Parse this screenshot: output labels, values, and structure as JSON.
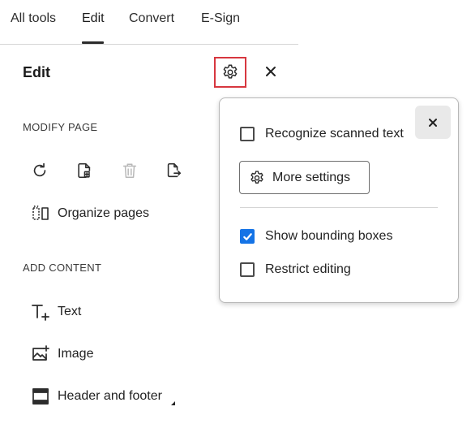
{
  "tabs": [
    {
      "label": "All tools"
    },
    {
      "label": "Edit",
      "active": true
    },
    {
      "label": "Convert"
    },
    {
      "label": "E-Sign"
    }
  ],
  "panel": {
    "title": "Edit",
    "settings_icon": "gear-icon",
    "close_icon": "close-icon"
  },
  "modify_page": {
    "label": "MODIFY PAGE",
    "icons": [
      "rotate-icon",
      "insert-page-icon",
      "delete-page-icon",
      "extract-page-icon"
    ],
    "organize_label": "Organize pages"
  },
  "add_content": {
    "label": "ADD CONTENT",
    "items": [
      {
        "label": "Text",
        "icon": "add-text-icon"
      },
      {
        "label": "Image",
        "icon": "add-image-icon"
      },
      {
        "label": "Header and footer",
        "icon": "header-footer-icon"
      }
    ]
  },
  "popover": {
    "recognize_text": {
      "label": "Recognize scanned text",
      "checked": false
    },
    "more_settings_label": "More settings",
    "show_bounding_boxes": {
      "label": "Show bounding boxes",
      "checked": true
    },
    "restrict_editing": {
      "label": "Restrict editing",
      "checked": false
    }
  },
  "colors": {
    "highlight_border": "#d7373f",
    "checkbox_accent": "#1473e6"
  }
}
